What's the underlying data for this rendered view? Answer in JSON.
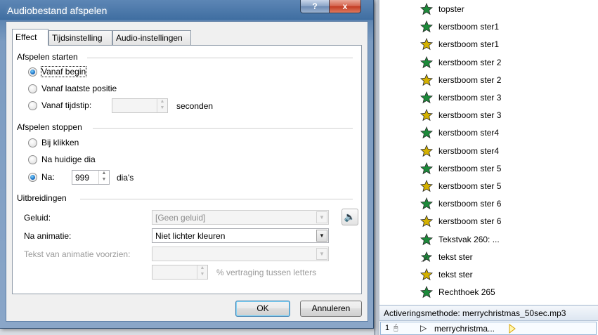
{
  "dialog": {
    "title": "Audiobestand afspelen",
    "help_label": "?",
    "close_label": "x",
    "tabs": [
      {
        "label": "Effect"
      },
      {
        "label": "Tijdsinstelling"
      },
      {
        "label": "Audio-instellingen"
      }
    ],
    "start_group": {
      "title": "Afspelen starten",
      "options": [
        {
          "label": "Vanaf begin",
          "checked": true
        },
        {
          "label": "Vanaf laatste positie",
          "checked": false
        },
        {
          "label": "Vanaf tijdstip:",
          "checked": false
        }
      ],
      "time_value": "",
      "time_unit": "seconden"
    },
    "stop_group": {
      "title": "Afspelen stoppen",
      "options": [
        {
          "label": "Bij klikken",
          "checked": false
        },
        {
          "label": "Na huidige dia",
          "checked": false
        },
        {
          "label": "Na:",
          "checked": true
        }
      ],
      "slides_value": "999",
      "slides_unit": "dia's"
    },
    "enhancements": {
      "title": "Uitbreidingen",
      "sound_label": "Geluid:",
      "sound_value": "[Geen geluid]",
      "after_anim_label": "Na animatie:",
      "after_anim_value": "Niet lichter kleuren",
      "animate_text_label": "Tekst van animatie voorzien:",
      "animate_text_value": "",
      "delay_value": "",
      "delay_label": "% vertraging tussen letters"
    },
    "ok_label": "OK",
    "cancel_label": "Annuleren"
  },
  "animation_pane": {
    "items": [
      {
        "label": "topster",
        "icon": "star-entrance-icon",
        "color": "#1d8a3a"
      },
      {
        "label": "kerstboom ster1",
        "icon": "star-entrance-icon",
        "color": "#1d8a3a"
      },
      {
        "label": "kerstboom ster1",
        "icon": "star-emphasis-icon",
        "color": "#d4b100"
      },
      {
        "label": "kerstboom ster 2",
        "icon": "star-entrance-icon",
        "color": "#1d8a3a"
      },
      {
        "label": "kerstboom ster 2",
        "icon": "star-emphasis-icon",
        "color": "#d4b100"
      },
      {
        "label": "kerstboom ster 3",
        "icon": "star-entrance-icon",
        "color": "#1d8a3a"
      },
      {
        "label": "kerstboom ster 3",
        "icon": "star-emphasis-icon",
        "color": "#d4b100"
      },
      {
        "label": "kerstboom ster4",
        "icon": "star-entrance-icon",
        "color": "#1d8a3a"
      },
      {
        "label": "kerstboom ster4",
        "icon": "star-emphasis-icon",
        "color": "#d4b100"
      },
      {
        "label": "kerstboom ster 5",
        "icon": "star-entrance-icon",
        "color": "#1d8a3a"
      },
      {
        "label": "kerstboom ster 5",
        "icon": "star-emphasis-icon",
        "color": "#d4b100"
      },
      {
        "label": "kerstboom ster 6",
        "icon": "star-entrance-icon",
        "color": "#1d8a3a"
      },
      {
        "label": "kerstboom ster 6",
        "icon": "star-emphasis-icon",
        "color": "#d4b100"
      },
      {
        "label": "Tekstvak 260: ...",
        "icon": "entrance-effect-icon",
        "color": "#1d8a3a"
      },
      {
        "label": "tekst ster",
        "icon": "motion-path-icon",
        "color": "#1d8a3a"
      },
      {
        "label": "tekst ster",
        "icon": "burst-effect-icon",
        "color": "#d4b100"
      },
      {
        "label": "Rechthoek 265",
        "icon": "entrance-effect-icon",
        "color": "#1d8a3a"
      }
    ],
    "trigger_label": "Activeringsmethode: merrychristmas_50sec.mp3",
    "selected_item": {
      "number": "1",
      "name": "merrychristma..."
    }
  }
}
